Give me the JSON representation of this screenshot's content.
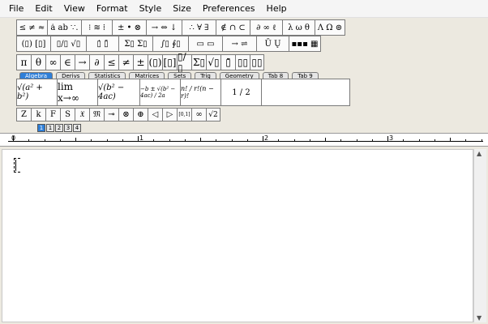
{
  "menu": [
    "File",
    "Edit",
    "View",
    "Format",
    "Style",
    "Size",
    "Preferences",
    "Help"
  ],
  "palette_row1": [
    "≤ ≠ ≈",
    "ȧ ab ∵.",
    "⁝ ≋ ⁞",
    "± • ⊗",
    "→ ⇔ ↓",
    "∴ ∀ ∃",
    "∉ ∩ ⊂",
    "∂ ∞ ℓ",
    "λ ω θ",
    "Λ Ω ⊚"
  ],
  "palette_row2": [
    "(▯) [▯]",
    "▯/▯ √▯",
    "▯̇ ▯̄",
    "Σ▯ Σ▯",
    "∫▯ ∮▯",
    "▭ ▭",
    "→ ⇌",
    "Ū Ų",
    "▪▪▪ ▦"
  ],
  "palette_row3": [
    "π",
    "θ",
    "∞",
    "∈",
    "→",
    "∂",
    "≤",
    "≠",
    "±",
    "(▯)",
    "[▯]",
    "▯/▯",
    "Σ▯",
    "√▯",
    "▯̄",
    "▯▯",
    "▯▯"
  ],
  "tabs": [
    "Algebra",
    "Derivs",
    "Statistics",
    "Matrices",
    "Sets",
    "Trig",
    "Geometry",
    "Tab 8",
    "Tab 9"
  ],
  "templates": [
    "√(a² + b²)",
    "lim x→∞",
    "√(b² − 4ac)",
    "−b ± √(b² − 4ac) / 2a",
    "n! / r!(n − r)!",
    "1 / 2"
  ],
  "palette_row4": [
    "Z",
    "k",
    "F",
    "S",
    "𝔛",
    "𝔐",
    "⊸",
    "⊗",
    "⊕",
    "◁",
    "▷",
    "[0,1]",
    "∞",
    "√2"
  ],
  "mini_icons": [
    "1",
    "1",
    "2",
    "3",
    "4"
  ],
  "ruler_numbers": [
    "0",
    "1",
    "2",
    "3"
  ],
  "colors": {
    "active_tab": "#2f7fd8",
    "toolbar_bg": "#ece9e0",
    "editor_bg": "#ffffff"
  }
}
